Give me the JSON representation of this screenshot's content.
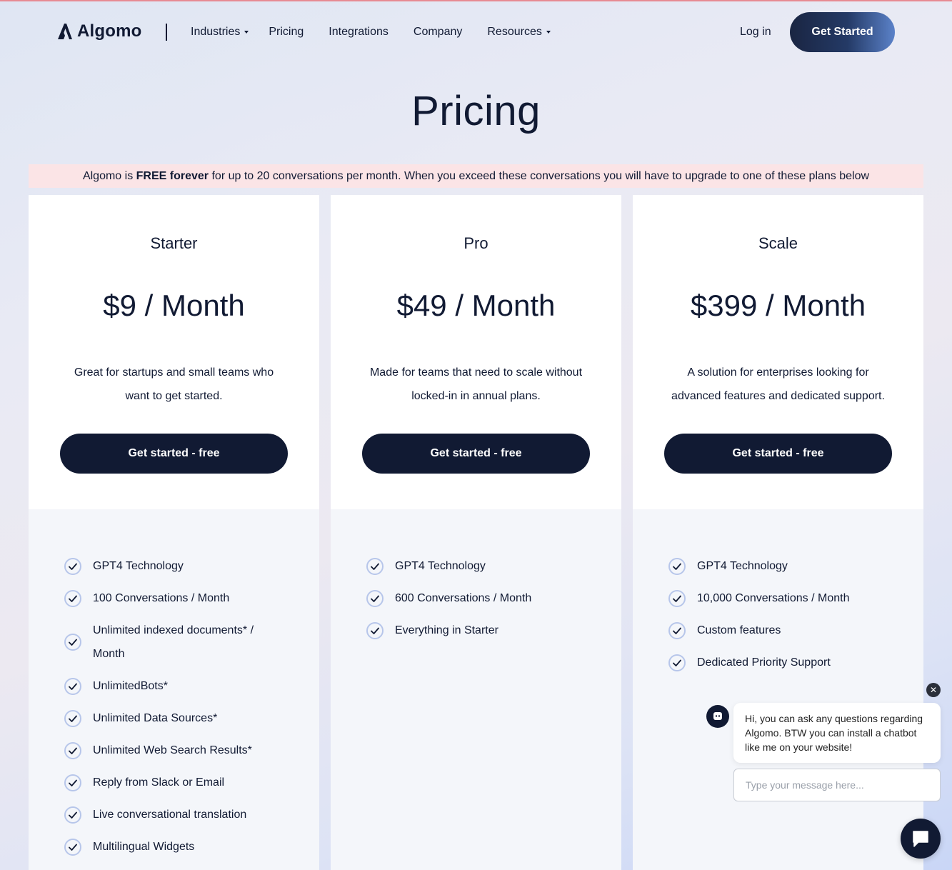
{
  "header": {
    "logo_text": "Algomo",
    "nav": [
      {
        "label": "Industries",
        "dropdown": true
      },
      {
        "label": "Pricing",
        "dropdown": false
      },
      {
        "label": "Integrations",
        "dropdown": false
      },
      {
        "label": "Company",
        "dropdown": false
      },
      {
        "label": "Resources",
        "dropdown": true
      }
    ],
    "login_label": "Log in",
    "cta_label": "Get Started"
  },
  "page_title": "Pricing",
  "banner": {
    "prefix": "Algomo is ",
    "bold": "FREE forever",
    "suffix": " for up to 20 conversations per month. When you exceed these conversations you will have to upgrade to one of these plans below"
  },
  "plans": [
    {
      "name": "Starter",
      "price": "$9 / Month",
      "description": "Great for startups and small teams who want to get started.",
      "button_label": "Get started - free",
      "features": [
        "GPT4 Technology",
        "100 Conversations / Month",
        "Unlimited indexed documents* / Month",
        "UnlimitedBots*",
        "Unlimited Data Sources*",
        "Unlimited Web Search Results*",
        "Reply from Slack or Email",
        "Live conversational translation",
        "Multilingual Widgets"
      ]
    },
    {
      "name": "Pro",
      "price": "$49 / Month",
      "description": "Made for teams that need to scale without locked-in in annual plans.",
      "button_label": "Get started - free",
      "features": [
        "GPT4 Technology",
        "600 Conversations / Month",
        "Everything in Starter"
      ]
    },
    {
      "name": "Scale",
      "price": "$399 / Month",
      "description": "A solution for enterprises looking for advanced features and dedicated support.",
      "button_label": "Get started - free",
      "features": [
        "GPT4 Technology",
        "10,000 Conversations / Month",
        "Custom features",
        "Dedicated Priority Support"
      ]
    }
  ],
  "chat": {
    "message": "Hi, you can ask any questions regarding Algomo. BTW you can install a chatbot like me on your website!",
    "input_placeholder": "Type your message here...",
    "close_icon": "close-icon",
    "launcher_icon": "chat-bubble-icon"
  },
  "colors": {
    "navy": "#111a33",
    "banner_bg": "#fbe4e6",
    "check_ring": "#b7c6ea"
  }
}
